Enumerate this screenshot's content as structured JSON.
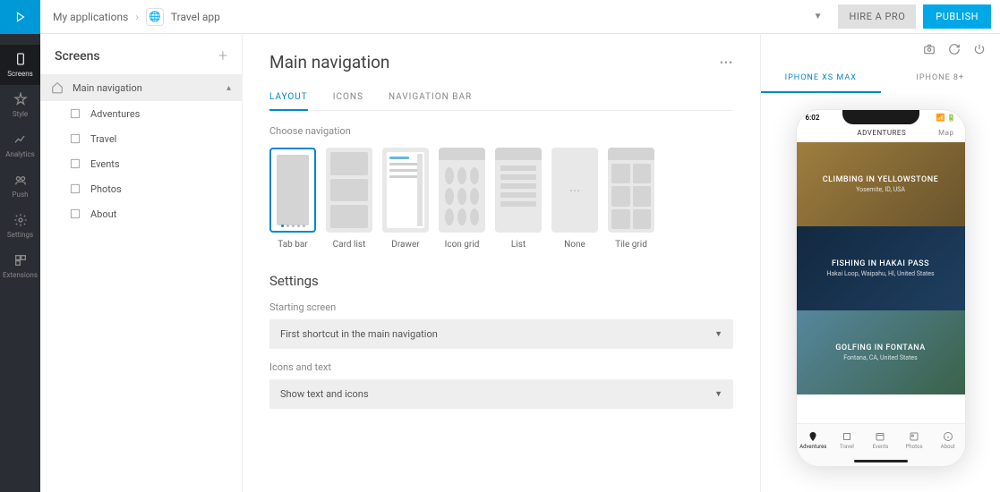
{
  "breadcrumb": {
    "root": "My applications",
    "app": "Travel app"
  },
  "topbar": {
    "hire": "HIRE A PRO",
    "publish": "PUBLISH"
  },
  "rail": [
    {
      "name": "Screens"
    },
    {
      "name": "Style"
    },
    {
      "name": "Analytics"
    },
    {
      "name": "Push"
    },
    {
      "name": "Settings"
    },
    {
      "name": "Extensions"
    }
  ],
  "screens": {
    "title": "Screens",
    "items": [
      {
        "label": "Main navigation"
      },
      {
        "label": "Adventures"
      },
      {
        "label": "Travel"
      },
      {
        "label": "Events"
      },
      {
        "label": "Photos"
      },
      {
        "label": "About"
      }
    ]
  },
  "main": {
    "title": "Main navigation",
    "tabs": [
      "LAYOUT",
      "ICONS",
      "NAVIGATION BAR"
    ],
    "choose_label": "Choose navigation",
    "nav_options": [
      "Tab bar",
      "Card list",
      "Drawer",
      "Icon grid",
      "List",
      "None",
      "Tile grid"
    ],
    "settings_title": "Settings",
    "starting_label": "Starting screen",
    "starting_value": "First shortcut in the main navigation",
    "icons_label": "Icons and text",
    "icons_value": "Show text and icons"
  },
  "preview": {
    "device_tabs": [
      "IPHONE XS MAX",
      "IPHONE 8+"
    ],
    "time": "6:02",
    "header": "ADVENTURES",
    "map": "Map",
    "cards": [
      {
        "title": "CLIMBING IN YELLOWSTONE",
        "sub": "Yosemite, ID, USA"
      },
      {
        "title": "FISHING IN HAKAI PASS",
        "sub": "Hakai Loop, Waipahu, HI, United States"
      },
      {
        "title": "GOLFING IN FONTANA",
        "sub": "Fontana, CA, United States"
      }
    ],
    "tabs": [
      "Adventures",
      "Travel",
      "Events",
      "Photos",
      "About"
    ]
  }
}
